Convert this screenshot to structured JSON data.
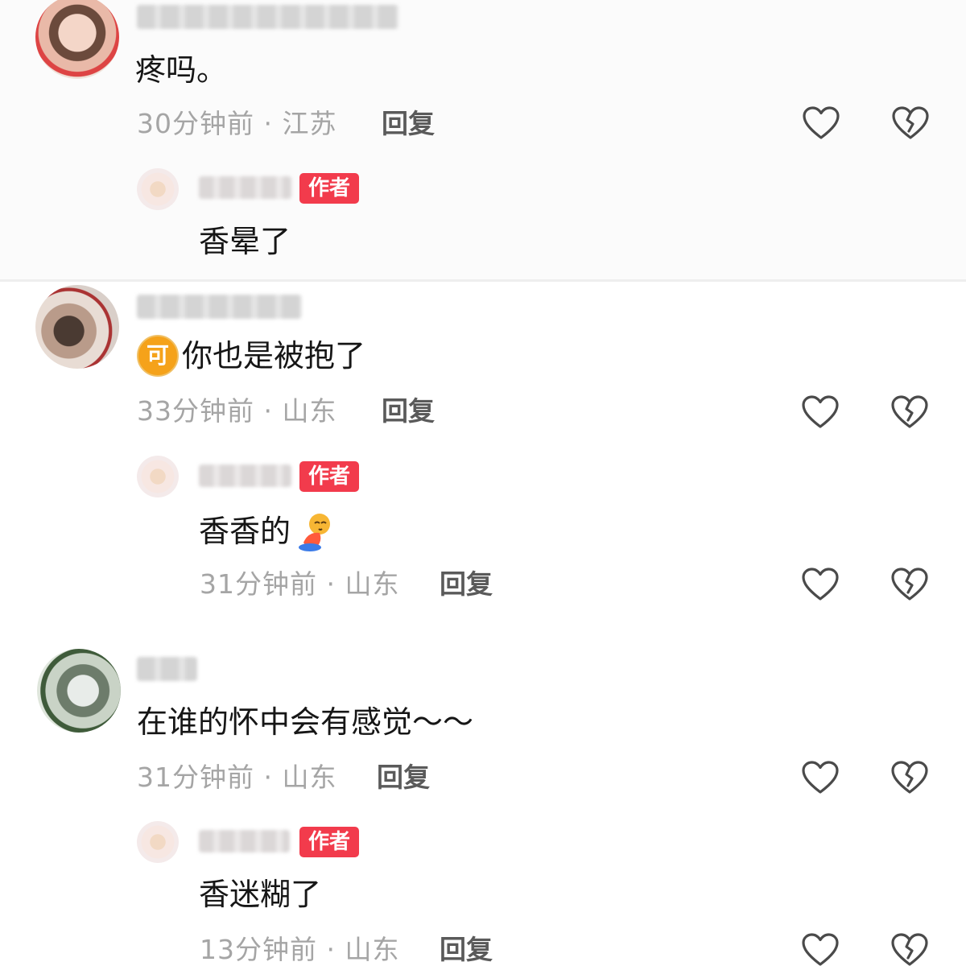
{
  "comments": [
    {
      "text": "疼吗。",
      "meta": "30分钟前 · 江苏",
      "reply_label": "回复",
      "author_reply": {
        "badge": "作者",
        "text": "香晕了"
      }
    },
    {
      "badge_char": "可",
      "text": "你也是被抱了",
      "meta": "33分钟前 · 山东",
      "reply_label": "回复",
      "author_reply": {
        "badge": "作者",
        "text": "香香的",
        "emoji": "praying-emoji",
        "meta": "31分钟前 · 山东",
        "reply_label": "回复"
      }
    },
    {
      "text": "在谁的怀中会有感觉～～",
      "meta": "31分钟前 · 山东",
      "reply_label": "回复",
      "author_reply": {
        "badge": "作者",
        "text": "香迷糊了",
        "meta": "13分钟前 · 山东",
        "reply_label": "回复"
      }
    }
  ],
  "icons": {
    "like": "heart-outline-icon",
    "dislike": "broken-heart-icon"
  },
  "colors": {
    "author_tag": "#f23b4c",
    "meta_text": "#a5a5a5",
    "reply_text": "#5a5a5a"
  }
}
